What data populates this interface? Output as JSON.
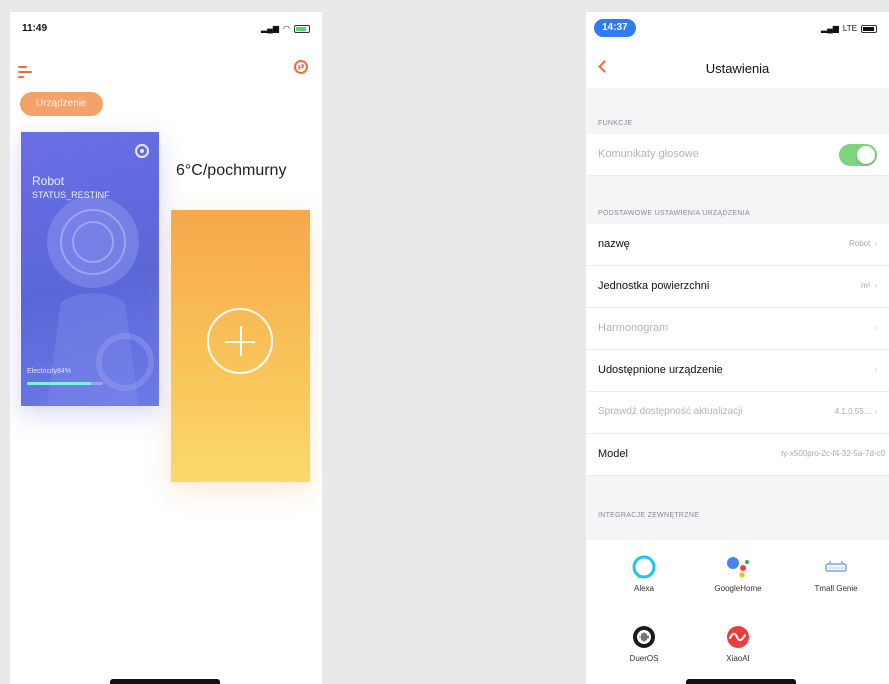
{
  "left_screen": {
    "status": {
      "time": "11:49"
    },
    "device_tag": "Urządzenie",
    "robot_card": {
      "name": "Robot",
      "status": "STATUS_RESTINF",
      "electricity_label": "Electricity84%",
      "electricity_level": 0.84
    },
    "weather": "6°C/pochmurny"
  },
  "right_screen": {
    "status": {
      "time": "14:37",
      "network": "LTE"
    },
    "title": "Ustawienia",
    "sections": {
      "functions": "FUNKCJE",
      "basic": "PODSTAWOWE USTAWIENIA URZĄDZENIA",
      "integrations": "INTEGRACJE ZEWNĘTRZNE"
    },
    "rows": {
      "voice_prompts": {
        "label": "Komunikaty głosowe",
        "enabled": true
      },
      "name": {
        "label": "nazwę",
        "value": "Robot"
      },
      "area_unit": {
        "label": "Jednostka powierzchni",
        "value": "m²"
      },
      "schedule": {
        "label": "Harmonogram"
      },
      "shared_device": {
        "label": "Udostępnione urządzenie"
      },
      "check_update": {
        "label": "Sprawdź dostępność aktualizacji",
        "value": "4.1.0,55..."
      },
      "model": {
        "label": "Model",
        "value": "ty-x500pro-2c-f4-32-5a-7d-c0"
      }
    },
    "integrations": [
      {
        "label": "Alexa",
        "icon": "alexa-icon"
      },
      {
        "label": "GoogleHome",
        "icon": "google-assistant-icon"
      },
      {
        "label": "Tmall Genie",
        "icon": "tmall-genie-icon"
      },
      {
        "label": "DuerOS",
        "icon": "dueros-icon"
      },
      {
        "label": "XiaoAI",
        "icon": "xiaoai-icon"
      }
    ]
  },
  "colors": {
    "accent": "#f26b3a",
    "robot_card": "#5a67d8",
    "add_card": "#f7a84b",
    "toggle_on": "#7ed47f",
    "time_pill": "#2f7bf5"
  }
}
